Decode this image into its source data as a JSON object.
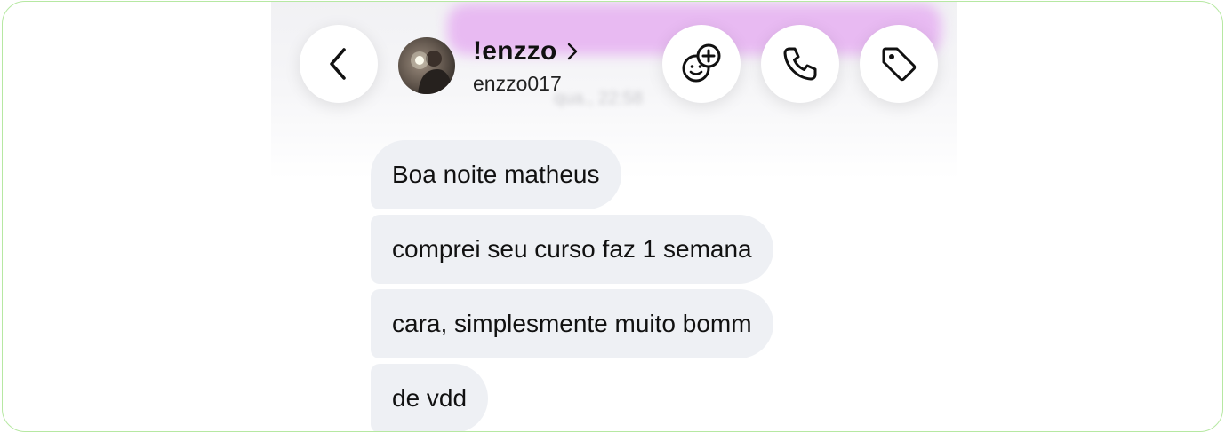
{
  "header": {
    "back_icon": "chevron-left-icon",
    "contact": {
      "name": "!enzzo",
      "handle": "enzzo017",
      "chevron_icon": "chevron-right-icon"
    },
    "actions": [
      {
        "icon": "effects-add-icon"
      },
      {
        "icon": "phone-icon"
      },
      {
        "icon": "tag-icon"
      }
    ]
  },
  "messages": [
    {
      "text": "Boa noite matheus"
    },
    {
      "text": "comprei seu curso faz 1 semana"
    },
    {
      "text": "cara, simplesmente muito bomm"
    },
    {
      "text": "de vdd"
    }
  ],
  "colors": {
    "bubble_bg": "#eef0f4",
    "header_glow": "#e7b4f2",
    "frame_border": "#b6e8a2"
  }
}
